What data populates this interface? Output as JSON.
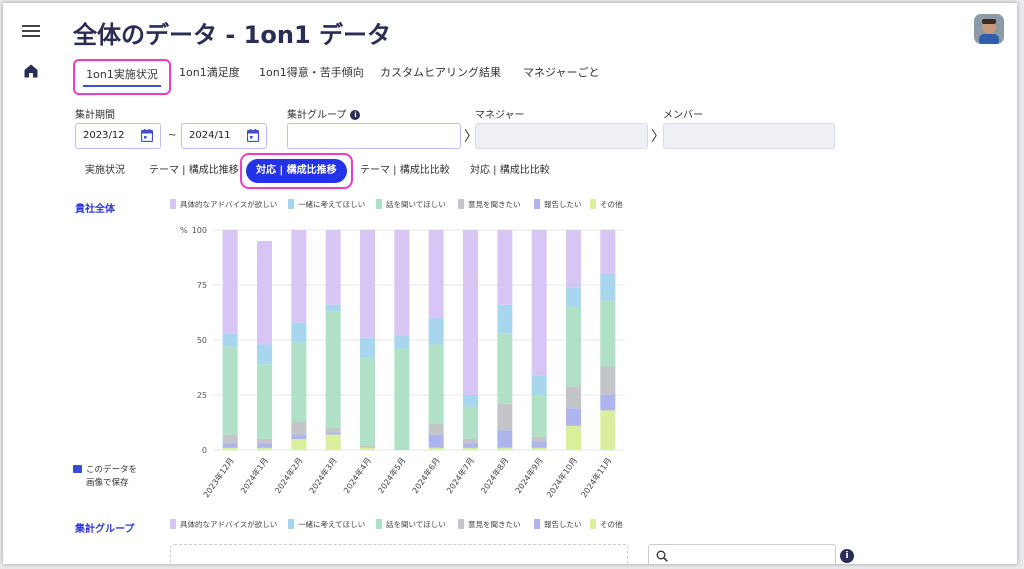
{
  "page": {
    "title": "全体のデータ - 1on1 データ"
  },
  "tabs": [
    "1on1実施状況",
    "1on1満足度",
    "1on1得意・苦手傾向",
    "カスタムヒアリング結果",
    "マネジャーごと"
  ],
  "filters": {
    "period_label": "集計期間",
    "period_start": "2023/12",
    "period_end": "2024/11",
    "tilde": "~",
    "group_label": "集計グループ",
    "group_value": "",
    "manager_label": "マネジャー",
    "member_label": "メンバー"
  },
  "subtabs": [
    "実施状況",
    "テーマ | 構成比推移",
    "対応 | 構成比推移",
    "テーマ | 構成比比較",
    "対応 | 構成比比較"
  ],
  "legend": [
    "具体的なアドバイスが欲しい",
    "一緒に考えてほしい",
    "話を聞いてほしい",
    "意見を聞きたい",
    "報告したい",
    "その他"
  ],
  "section_company": "貴社全体",
  "section_group": "集計グループ",
  "save_button": {
    "line1": "このデータを",
    "line2": "画像で保存"
  },
  "colors": {
    "series": [
      "#d7c6f4",
      "#a8d6ee",
      "#b0e0c6",
      "#c3c5c9",
      "#aeb4ee",
      "#d9ef9c"
    ],
    "accent": "#2334e8",
    "highlight": "#e93fc2"
  },
  "icons": [
    "menu-icon",
    "home-icon",
    "calendar-icon",
    "info-icon",
    "chevron-right-icon",
    "image-icon",
    "search-icon"
  ],
  "chart_data": {
    "type": "bar",
    "stacked": true,
    "ylabel": "%",
    "ylim": [
      0,
      100
    ],
    "yticks": [
      0,
      25,
      50,
      75,
      100
    ],
    "categories": [
      "2023年12月",
      "2024年1月",
      "2024年2月",
      "2024年3月",
      "2024年4月",
      "2024年5月",
      "2024年6月",
      "2024年7月",
      "2024年8月",
      "2024年9月",
      "2024年10月",
      "2024年11月"
    ],
    "series": [
      {
        "name": "具体的なアドバイスが欲しい",
        "values": [
          47,
          47,
          42,
          34,
          49,
          48,
          40,
          75,
          34,
          66,
          26,
          20
        ]
      },
      {
        "name": "一緒に考えてほしい",
        "values": [
          6,
          9,
          9,
          3,
          9,
          6,
          12,
          5,
          13,
          9,
          9,
          12
        ]
      },
      {
        "name": "話を聞いてほしい",
        "values": [
          40,
          34,
          36,
          53,
          40,
          46,
          36,
          15,
          32,
          19,
          36,
          30
        ]
      },
      {
        "name": "意見を聞きたい",
        "values": [
          4,
          2,
          6,
          2,
          1,
          0,
          5,
          2,
          12,
          2,
          10,
          13
        ]
      },
      {
        "name": "報告したい",
        "values": [
          2,
          2,
          2,
          1,
          0,
          0,
          6,
          2,
          8,
          3,
          8,
          7
        ]
      },
      {
        "name": "その他",
        "values": [
          1,
          1,
          5,
          7,
          1,
          0,
          1,
          1,
          1,
          1,
          11,
          18
        ]
      }
    ]
  }
}
